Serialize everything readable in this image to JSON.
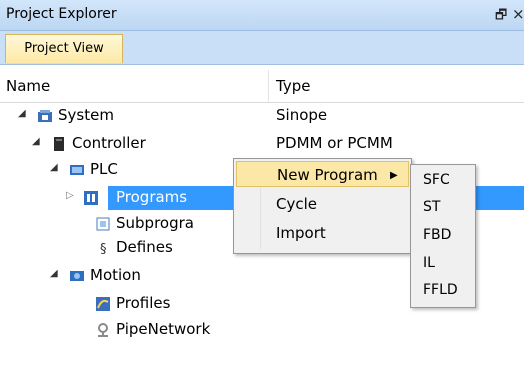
{
  "window": {
    "title": "Project Explorer",
    "pin_glyph": "🗗",
    "close_glyph": "×"
  },
  "tabs": [
    {
      "label": "Project View"
    }
  ],
  "columns": {
    "name": "Name",
    "type": "Type"
  },
  "tree": {
    "system": {
      "label": "System",
      "type": "Sinope",
      "icon": "system-icon"
    },
    "controller": {
      "label": "Controller",
      "type": "PDMM or PCMM",
      "icon": "controller-icon"
    },
    "plc": {
      "label": "PLC",
      "icon": "plc-icon"
    },
    "programs": {
      "label": "Programs",
      "icon": "programs-icon",
      "selected": true
    },
    "subprograms": {
      "label": "Subprogra",
      "icon": "subprograms-icon"
    },
    "defines": {
      "label": "Defines",
      "icon": "defines-icon"
    },
    "motion": {
      "label": "Motion",
      "icon": "motion-icon"
    },
    "profiles": {
      "label": "Profiles",
      "icon": "profiles-icon"
    },
    "pipenetwork": {
      "label": "PipeNetwork",
      "icon": "pipenetwork-icon"
    }
  },
  "context_menu": {
    "items": [
      {
        "label": "New Program"
      },
      {
        "label": "Cycle"
      },
      {
        "label": "Import"
      }
    ]
  },
  "submenu": {
    "items": [
      "SFC",
      "ST",
      "FBD",
      "IL",
      "FFLD"
    ]
  },
  "colors": {
    "selection": "#3399ff",
    "menu_highlight": "#fbe8a6",
    "tab": "#fde9a6"
  }
}
